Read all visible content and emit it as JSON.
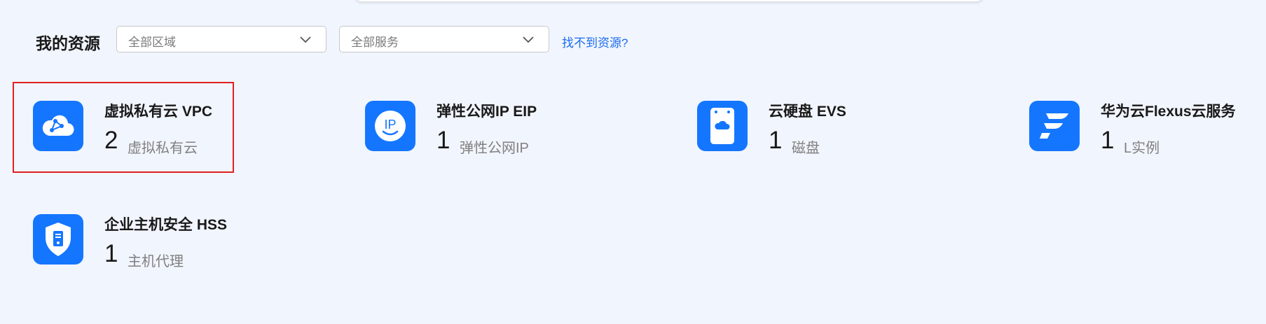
{
  "header": {
    "title": "我的资源",
    "region_select": {
      "value": "全部区域"
    },
    "service_select": {
      "value": "全部服务"
    },
    "help_link": "找不到资源?"
  },
  "resources": [
    {
      "name": "虚拟私有云 VPC",
      "count": "2",
      "unit": "虚拟私有云",
      "icon": "vpc-cloud-icon",
      "selected": true
    },
    {
      "name": "弹性公网IP EIP",
      "count": "1",
      "unit": "弹性公网IP",
      "icon": "eip-icon"
    },
    {
      "name": "云硬盘 EVS",
      "count": "1",
      "unit": "磁盘",
      "icon": "evs-disk-icon"
    },
    {
      "name": "华为云Flexus云服务",
      "count": "1",
      "unit": "L实例",
      "icon": "flexus-icon"
    },
    {
      "name": "企业主机安全 HSS",
      "count": "1",
      "unit": "主机代理",
      "icon": "hss-shield-icon"
    }
  ],
  "colors": {
    "accent": "#1476ff",
    "link": "#1a6cf0",
    "background": "#f1f5fd",
    "selection_border": "#e02020"
  }
}
